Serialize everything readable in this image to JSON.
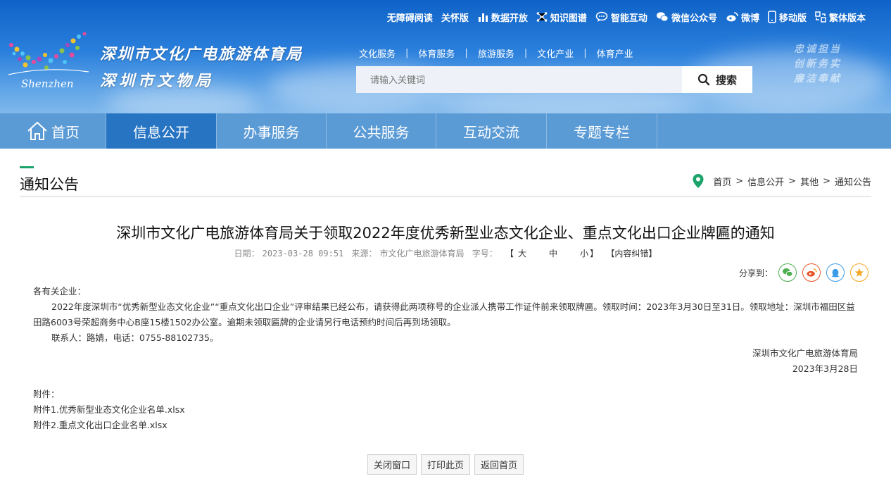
{
  "top_links": [
    {
      "label": "无障碍阅读",
      "icon": ""
    },
    {
      "label": "关怀版",
      "icon": ""
    },
    {
      "label": "数据开放",
      "icon": "bar-chart-icon"
    },
    {
      "label": "知识图谱",
      "icon": "network-icon"
    },
    {
      "label": "智能互动",
      "icon": "chat-bubble-icon"
    },
    {
      "label": "微信公众号",
      "icon": "wechat-icon"
    },
    {
      "label": "微博",
      "icon": "weibo-icon"
    },
    {
      "label": "移动版",
      "icon": "mobile-icon"
    },
    {
      "label": "繁体版本",
      "icon": "traditional-icon"
    }
  ],
  "logo": {
    "name_line1": "深圳市文化广电旅游体育局",
    "name_line2": "深圳市文物局",
    "mark_text": "Shenzhen"
  },
  "slogan": {
    "line1": "忠诚担当",
    "line2": "创新务实",
    "line3": "廉洁奉献"
  },
  "category_nav": [
    "文化服务",
    "体育服务",
    "旅游服务",
    "文化产业",
    "体育产业"
  ],
  "search": {
    "placeholder": "请输入关键词",
    "button_label": "搜索"
  },
  "main_nav": [
    {
      "label": "首页",
      "active": false
    },
    {
      "label": "信息公开",
      "active": true
    },
    {
      "label": "办事服务",
      "active": false
    },
    {
      "label": "公共服务",
      "active": false
    },
    {
      "label": "互动交流",
      "active": false
    },
    {
      "label": "专题专栏",
      "active": false
    }
  ],
  "section": {
    "title": "通知公告"
  },
  "breadcrumb": [
    "首页",
    "信息公开",
    "其他",
    "通知公告"
  ],
  "article": {
    "title": "深圳市文化广电旅游体育局关于领取2022年度优秀新型业态文化企业、重点文化出口企业牌匾的通知",
    "date_label": "日期：",
    "date": "2023-03-28 09:51",
    "source_label": "来源：",
    "source": "市文化广电旅游体育局",
    "font_size_label": "字号：",
    "font_sizes": [
      "大",
      "中",
      "小"
    ],
    "correction": "【内容纠错】",
    "share_label": "分享到：",
    "greeting": "各有关企业：",
    "para1": "2022年度深圳市“优秀新型业态文化企业”“重点文化出口企业”评审结果已经公布，请获得此两项称号的企业派人携带工作证件前来领取牌匾。领取时间：2023年3月30日至31日。领取地址：深圳市福田区益田路6003号荣超商务中心B座15楼1502办公室。逾期未领取匾牌的企业请另行电话预约时间后再到场领取。",
    "contact": "联系人：路婧，电话：0755-88102735。",
    "sign_org": "深圳市文化广电旅游体育局",
    "sign_date": "2023年3月28日",
    "attach_title": "附件：",
    "attachments": [
      "附件1.优秀新型业态文化企业名单.xlsx",
      "附件2.重点文化出口企业名单.xlsx"
    ]
  },
  "actions": [
    "关闭窗口",
    "打印此页",
    "返回首页"
  ],
  "colors": {
    "nav_bg": "#5a9ad5",
    "nav_active": "#2774c2",
    "accent_green": "#1aa36a",
    "banner_top": "#0f63c8"
  }
}
